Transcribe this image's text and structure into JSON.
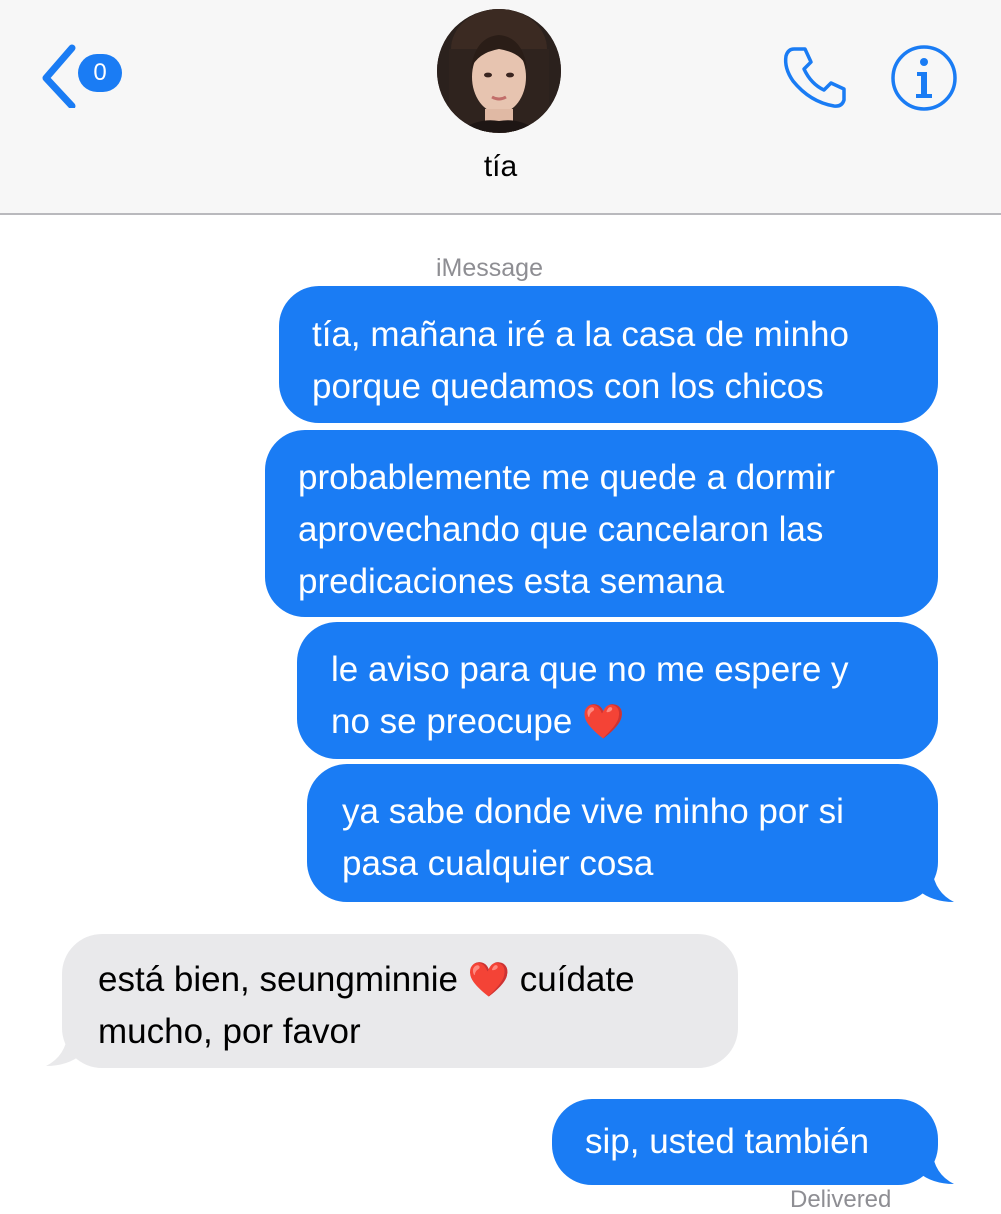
{
  "header": {
    "back_badge": "0",
    "contact_name": "tía",
    "icons": {
      "back": "chevron-left-icon",
      "call": "phone-icon",
      "info": "info-icon",
      "avatar": "contact-photo"
    }
  },
  "conversation": {
    "service_label": "iMessage",
    "heart": "❤️",
    "messages": [
      {
        "direction": "outgoing",
        "lines": [
          "tía, mañana iré a la casa de minho",
          "porque quedamos con los chicos"
        ]
      },
      {
        "direction": "outgoing",
        "lines": [
          "probablemente me quede a dormir",
          "aprovechando que cancelaron las",
          "predicaciones esta semana"
        ]
      },
      {
        "direction": "outgoing",
        "lines": [
          "le aviso para que no me espere y",
          "no se preocupe "
        ]
      },
      {
        "direction": "outgoing",
        "lines": [
          "ya sabe donde vive minho por si",
          "pasa cualquier cosa"
        ]
      },
      {
        "direction": "incoming",
        "lines": [
          "está bien, seungminnie ",
          " cuídate",
          "mucho, por favor"
        ]
      },
      {
        "direction": "outgoing",
        "lines": [
          "sip, usted también"
        ]
      }
    ],
    "delivered_label": "Delivered"
  },
  "colors": {
    "outgoing_bubble": "#1a7cf4",
    "incoming_bubble": "#e9e9eb",
    "accent": "#1a7cf4",
    "header_bg": "#f7f7f7"
  }
}
